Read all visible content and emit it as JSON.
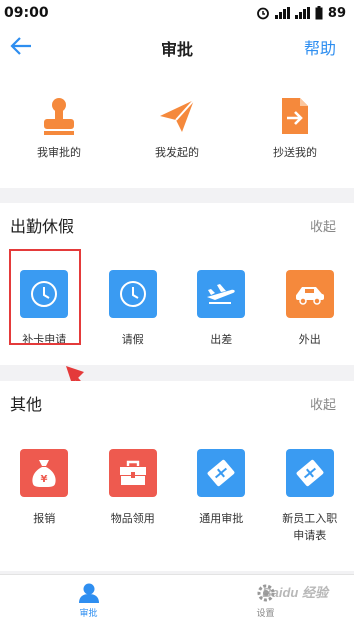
{
  "status_bar": {
    "time": "09:00",
    "battery": "89"
  },
  "nav": {
    "title": "审批",
    "help": "帮助"
  },
  "quick_actions": [
    {
      "label": "我审批的",
      "icon": "approver-stamp-icon"
    },
    {
      "label": "我发起的",
      "icon": "paper-plane-icon"
    },
    {
      "label": "抄送我的",
      "icon": "cc-document-icon"
    }
  ],
  "attendance": {
    "title": "出勤休假",
    "collapse": "收起",
    "items": [
      {
        "label": "补卡申请",
        "icon": "clock-icon"
      },
      {
        "label": "请假",
        "icon": "clock-icon"
      },
      {
        "label": "出差",
        "icon": "airplane-icon"
      },
      {
        "label": "外出",
        "icon": "car-icon"
      }
    ]
  },
  "other": {
    "title": "其他",
    "collapse": "收起",
    "items": [
      {
        "label": "报销",
        "icon": "money-bag-icon"
      },
      {
        "label": "物品领用",
        "icon": "toolbox-icon"
      },
      {
        "label": "通用审批",
        "icon": "handshake-icon"
      },
      {
        "label": "新员工入职申请表",
        "icon": "handshake-icon"
      }
    ]
  },
  "tabbar": [
    {
      "label": "审批",
      "icon": "person-icon",
      "active": true
    },
    {
      "label": "设置",
      "icon": "gear-icon",
      "active": false
    }
  ],
  "watermark": "Baidu 经验",
  "colors": {
    "accent": "#2e8ef0",
    "orange": "#f5893c",
    "red": "#ee5a4f",
    "blue_tile": "#3a9bf2",
    "highlight": "#e43a3a"
  }
}
